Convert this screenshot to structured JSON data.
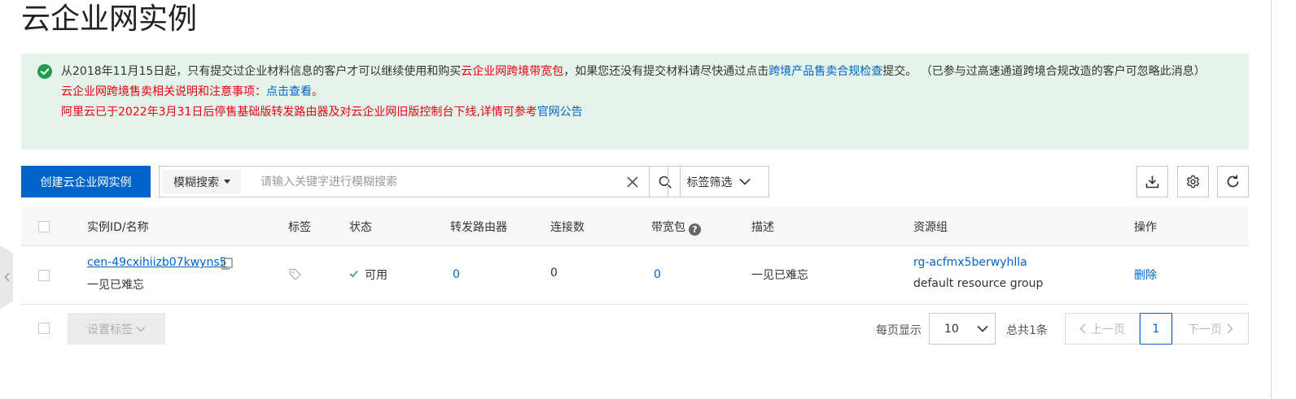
{
  "page": {
    "title": "云企业网实例"
  },
  "notice": {
    "line1_part1": "从2018年11月15日起，只有提交过企业材料信息的客户才可以继续使用和购买",
    "line1_red": "云企业网跨境带宽包",
    "line1_part2": "，如果您还没有提交材料请尽快通过点击",
    "line1_link": "跨境产品售卖合规检查",
    "line1_part3": "提交。  （已参与过高速通道跨境合规改造的客户可忽略此消息）",
    "line2_red": "云企业网跨境售卖相关说明和注意事项：",
    "line2_link": "点击查看",
    "line2_end": "。",
    "line3_red": "阿里云已于2022年3月31日后停售基础版转发路由器及对云企业网旧版控制台下线,详情可参考",
    "line3_link": "官网公告"
  },
  "toolbar": {
    "create_label": "创建云企业网实例",
    "search_type": "模糊搜索",
    "search_placeholder": "请输入关键字进行模糊搜索",
    "tag_filter_label": "标签筛选"
  },
  "table": {
    "headers": {
      "id_name": "实例ID/名称",
      "tags": "标签",
      "status": "状态",
      "tr": "转发路由器",
      "connections": "连接数",
      "bandwidth": "带宽包",
      "description": "描述",
      "resource_group": "资源组",
      "actions": "操作"
    },
    "rows": [
      {
        "id": "cen-49cxihiizb07kwyns5",
        "name": "一见已难忘",
        "status": "可用",
        "tr": "0",
        "connections": "0",
        "bandwidth": "0",
        "description": "一见已难忘",
        "rg_id": "rg-acfmx5berwyhlla",
        "rg_name": "default resource group",
        "action": "删除"
      }
    ]
  },
  "footer": {
    "set_tag_label": "设置标签",
    "per_page_label": "每页显示",
    "page_size": "10",
    "total_label": "总共1条",
    "prev_label": "上一页",
    "current_page": "1",
    "next_label": "下一页"
  },
  "colors": {
    "primary": "#0064c8",
    "notice_bg": "#e5f4eb",
    "success": "#1e9f4e",
    "danger": "#e60012"
  }
}
